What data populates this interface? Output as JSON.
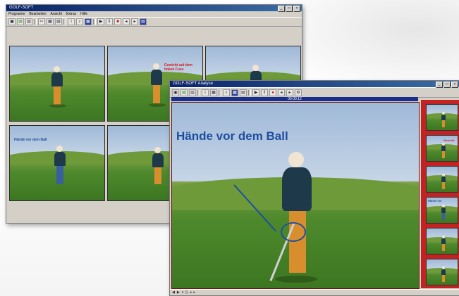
{
  "back_window": {
    "title": "GOLF-SOFT",
    "menu": [
      "Programm",
      "Bearbeiten",
      "Ansicht",
      "Extras",
      "Hilfe"
    ],
    "toolbar_icons": [
      "folder-icon",
      "save-icon",
      "print-icon",
      "cut-icon",
      "copy-icon",
      "paste-icon",
      "info-icon",
      "zoom-icon",
      "grid-icon",
      "play-icon",
      "pause-icon",
      "stop-icon",
      "prev-icon",
      "next-icon",
      "layout-icon"
    ],
    "frame_annotations": {
      "frame2": "Gewicht auf dem linken Fuss",
      "frame4": "Hände vor dem Ball"
    }
  },
  "front_window": {
    "title": "GOLF-SOFT Analyse",
    "position_label": "00:00:12",
    "main_annotation": "Hände vor dem Ball",
    "thumbnail_count": 6,
    "thumbnail_annotations": [
      "",
      "Gewicht",
      "",
      "Hände vor",
      "",
      ""
    ],
    "status_items": [
      "◀",
      "▶",
      "⏸",
      "||",
      "◂",
      "▸"
    ]
  },
  "colors": {
    "window_chrome": "#d4d0c8",
    "title_bar": "#0a246a",
    "annotation_blue": "#1e4ea0",
    "annotation_red": "#d81818",
    "thumb_strip": "#b41a1a"
  }
}
